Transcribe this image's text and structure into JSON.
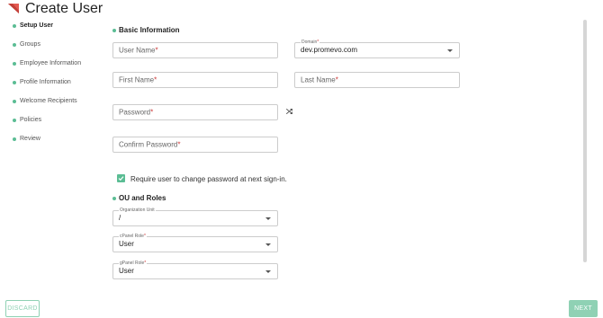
{
  "header": {
    "title": "Create User"
  },
  "steps": [
    {
      "label": "Setup User",
      "active": true
    },
    {
      "label": "Groups"
    },
    {
      "label": "Employee Information"
    },
    {
      "label": "Profile Information"
    },
    {
      "label": "Welcome Recipients"
    },
    {
      "label": "Policies"
    },
    {
      "label": "Review"
    }
  ],
  "basic_info": {
    "section_title": "Basic Information",
    "username_placeholder": "User Name",
    "domain": {
      "label": "Domain",
      "value": "dev.promevo.com"
    },
    "first_name_placeholder": "First Name",
    "last_name_placeholder": "Last Name",
    "password_placeholder": "Password",
    "confirm_password_placeholder": "Confirm Password",
    "required_mark": "*",
    "require_change_label": "Require user to change password at next sign-in.",
    "require_change_checked": true
  },
  "ou_roles": {
    "section_title": "OU and Roles",
    "org_unit": {
      "label": "Organization Unit",
      "value": "/"
    },
    "cpanel_role": {
      "label": "cPanel Role",
      "value": "User"
    },
    "gpanel_role": {
      "label": "gPanel Role",
      "value": "User"
    }
  },
  "footer": {
    "discard_label": "DISCARD",
    "next_label": "NEXT"
  },
  "colors": {
    "accent": "#5bbd94",
    "accent_light": "#8fd1b4",
    "logo": "#e35a52"
  }
}
